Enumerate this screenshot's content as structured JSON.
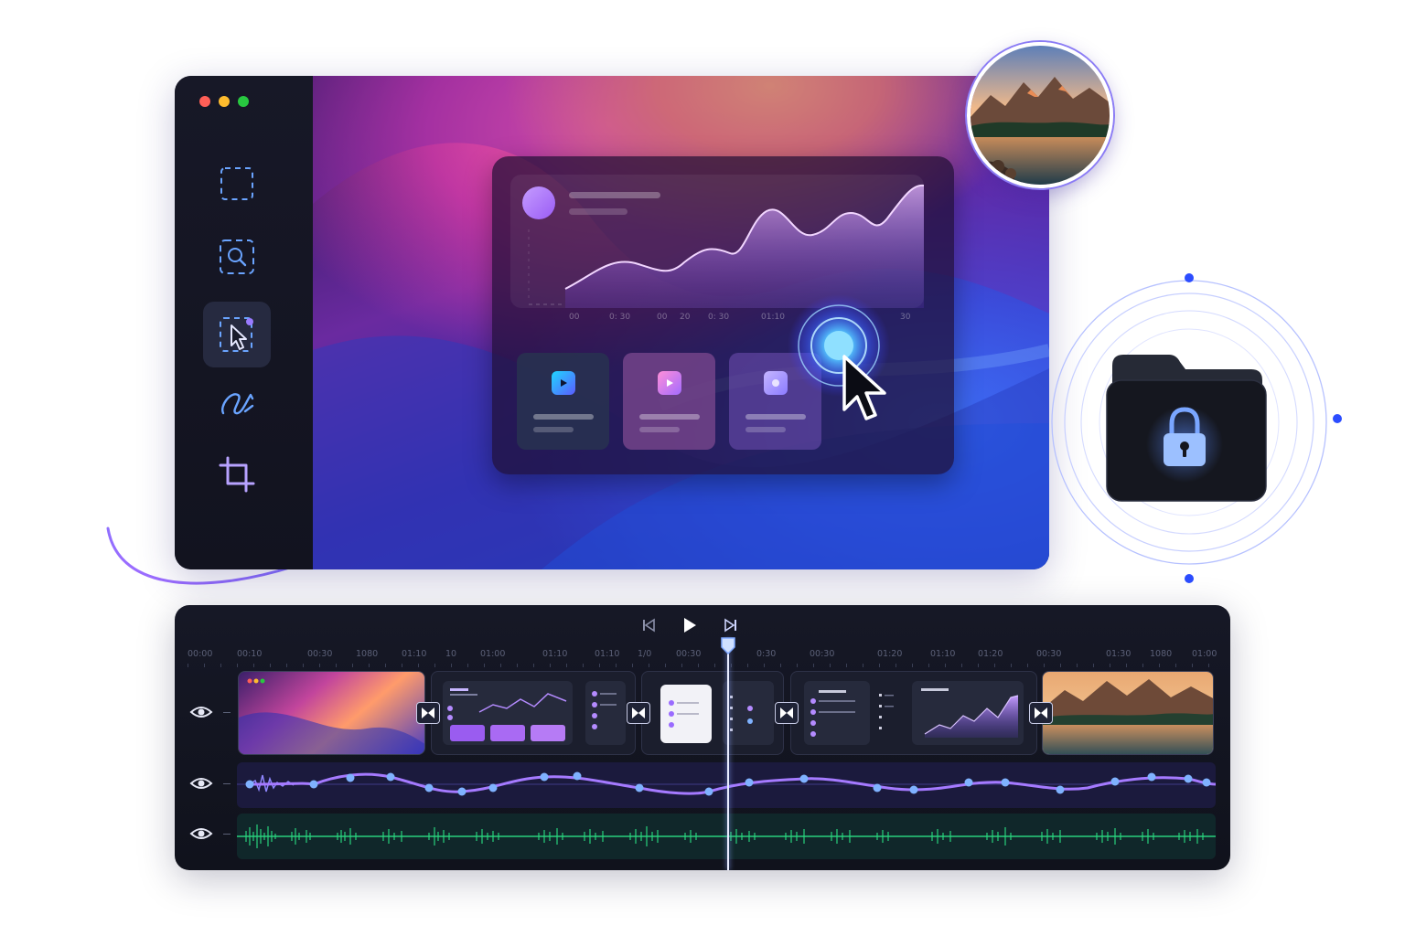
{
  "window": {
    "traffic_colors": [
      "#ff5f57",
      "#febc2e",
      "#28c840"
    ],
    "tools": [
      {
        "name": "marquee-select",
        "icon": "dashed-square-icon",
        "active": false
      },
      {
        "name": "zoom-select",
        "icon": "dashed-magnifier-icon",
        "active": false
      },
      {
        "name": "pointer-select",
        "icon": "dashed-cursor-icon",
        "active": true
      },
      {
        "name": "draw-path",
        "icon": "scribble-icon",
        "active": false
      },
      {
        "name": "crop",
        "icon": "crop-icon",
        "active": false
      }
    ]
  },
  "dashboard": {
    "time_ticks": [
      "00",
      "0: 30",
      "00",
      "20",
      "0: 30",
      "01:10",
      "30"
    ]
  },
  "timeline": {
    "ruler_labels": [
      "00:00",
      "00:10",
      "00:30",
      "1080",
      "01:10",
      "10",
      "01:00",
      "01:10",
      "01:10",
      "1/0",
      "00:30",
      "0:30",
      "00:30",
      "01:20",
      "01:10",
      "01:20",
      "00:30",
      "01:30",
      "1080",
      "01:00"
    ],
    "tracks": [
      {
        "type": "video",
        "visible": true
      },
      {
        "type": "voice-audio",
        "visible": true
      },
      {
        "type": "music-audio",
        "visible": true
      }
    ]
  },
  "colors": {
    "accent": "#6b7cff",
    "audio_purple": "#9a6bff",
    "audio_green": "#29d17c",
    "lock_glow": "#3f7bff"
  }
}
